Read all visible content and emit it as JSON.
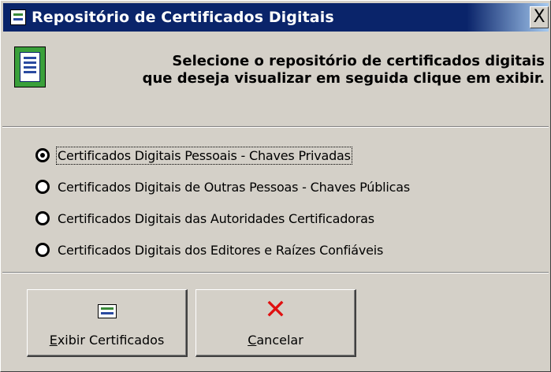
{
  "window": {
    "title": "Repositório de Certificados Digitais",
    "close_label": "X"
  },
  "header": {
    "line1": "Selecione o repositório de certificados digitais",
    "line2": "que deseja visualizar em seguida clique em exibir."
  },
  "options": [
    {
      "label": "Certificados Digitais Pessoais - Chaves Privadas",
      "selected": true
    },
    {
      "label": "Certificados Digitais de Outras Pessoas - Chaves Públicas",
      "selected": false
    },
    {
      "label": "Certificados Digitais das Autoridades Certificadoras",
      "selected": false
    },
    {
      "label": "Certificados Digitais dos Editores e Raízes Confiáveis",
      "selected": false
    }
  ],
  "buttons": {
    "view": {
      "mnemonic": "E",
      "rest": "xibir Certificados",
      "icon": "certificate-icon"
    },
    "cancel": {
      "mnemonic": "C",
      "rest": "ancelar",
      "icon": "cancel-x-icon"
    }
  },
  "colors": {
    "titlebar": "#0a246a",
    "face": "#d4d0c8",
    "cancel_icon": "#e01010"
  }
}
